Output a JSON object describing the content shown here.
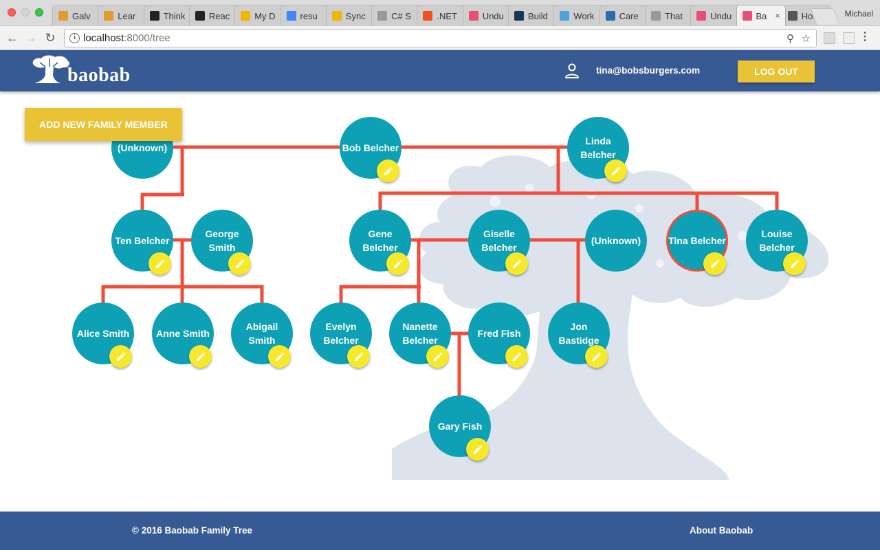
{
  "browser": {
    "tabs": [
      {
        "label": "Galv",
        "icon": "hand-icon",
        "color": "#e39b2d"
      },
      {
        "label": "Lear",
        "icon": "hand-icon",
        "color": "#e39b2d"
      },
      {
        "label": "Think",
        "icon": "react-icon",
        "color": "#222222"
      },
      {
        "label": "Reac",
        "icon": "react-icon",
        "color": "#222222"
      },
      {
        "label": "My D",
        "icon": "drive-icon",
        "color": "#f4b400"
      },
      {
        "label": "resu",
        "icon": "docs-icon",
        "color": "#4285f4"
      },
      {
        "label": "Sync",
        "icon": "drive-icon",
        "color": "#f4b400"
      },
      {
        "label": "C# S",
        "icon": "page-icon",
        "color": "#999999"
      },
      {
        "label": ".NET",
        "icon": "windows-icon",
        "color": "#f25022"
      },
      {
        "label": "Undu",
        "icon": "puzzle-icon",
        "color": "#e94e77"
      },
      {
        "label": "Build",
        "icon": "d-icon",
        "color": "#1d3557"
      },
      {
        "label": "Work",
        "icon": "drop-icon",
        "color": "#4aa3df"
      },
      {
        "label": "Care",
        "icon": "bracket-icon",
        "color": "#2b6cb0"
      },
      {
        "label": "That",
        "icon": "page-icon",
        "color": "#999999"
      },
      {
        "label": "Undu",
        "icon": "puzzle-icon",
        "color": "#e94e77"
      },
      {
        "label": "Ba",
        "icon": "puzzle-icon",
        "color": "#e94e77",
        "active": true
      },
      {
        "label": "How",
        "icon": "apple-icon",
        "color": "#555555"
      }
    ],
    "profile": "Michael",
    "url_host": "localhost",
    "url_rest": ":8000/tree"
  },
  "header": {
    "logo_text": "baobab",
    "user_email": "tina@bobsburgers.com",
    "logout_label": "LOG OUT"
  },
  "main": {
    "add_member_label": "ADD NEW FAMILY MEMBER"
  },
  "tree": {
    "line_color": "#f04e3a",
    "node_color": "#0ea1b5",
    "edit_color": "#f6e82b",
    "members": [
      {
        "id": "unknown-1",
        "label": "(Unknown)",
        "editable": false
      },
      {
        "id": "bob",
        "label": "Bob Belcher",
        "editable": true
      },
      {
        "id": "linda",
        "label": "Linda Belcher",
        "editable": true
      },
      {
        "id": "ten",
        "label": "Ten Belcher",
        "editable": true
      },
      {
        "id": "george",
        "label": "George Smith",
        "editable": true
      },
      {
        "id": "gene",
        "label": "Gene Belcher",
        "editable": true
      },
      {
        "id": "giselle",
        "label": "Giselle Belcher",
        "editable": true
      },
      {
        "id": "unknown-2",
        "label": "(Unknown)",
        "editable": false
      },
      {
        "id": "tina",
        "label": "Tina Belcher",
        "editable": true,
        "selected": true
      },
      {
        "id": "louise",
        "label": "Louise Belcher",
        "editable": true
      },
      {
        "id": "alice",
        "label": "Alice Smith",
        "editable": true
      },
      {
        "id": "anne",
        "label": "Anne Smith",
        "editable": true
      },
      {
        "id": "abigail",
        "label": "Abigail Smith",
        "editable": true
      },
      {
        "id": "evelyn",
        "label": "Evelyn Belcher",
        "editable": true
      },
      {
        "id": "nanette",
        "label": "Nanette Belcher",
        "editable": true
      },
      {
        "id": "fred",
        "label": "Fred Fish",
        "editable": true
      },
      {
        "id": "jon",
        "label": "Jon Bastidge",
        "editable": true
      },
      {
        "id": "gary",
        "label": "Gary Fish",
        "editable": true
      }
    ]
  },
  "footer": {
    "copyright": "© 2016 Baobab Family Tree",
    "about_label": "About Baobab"
  }
}
